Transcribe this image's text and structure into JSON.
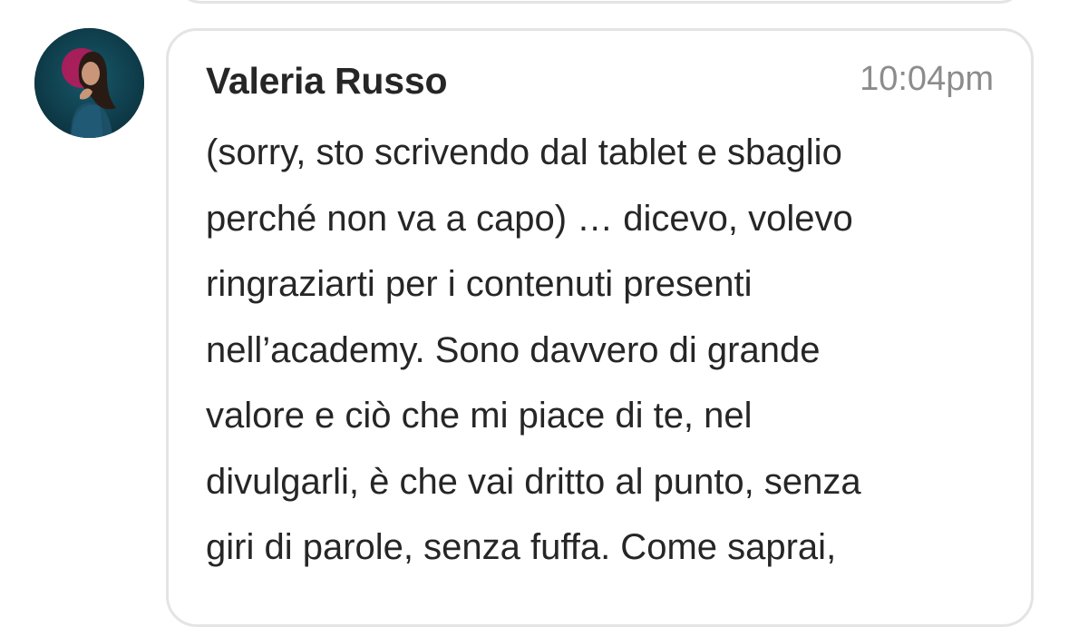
{
  "previous_message": {},
  "message": {
    "avatar_icon": "user-avatar-photo",
    "author": "Valeria Russo",
    "time": "10:04pm",
    "lines": [
      "(sorry, sto scrivendo dal tablet e sbaglio",
      "perché non va a capo) … dicevo, volevo",
      "ringraziarti per i contenuti presenti",
      "nell’academy. Sono davvero di grande",
      "valore e ciò che mi piace di te, nel",
      "divulgarli, è che vai dritto al punto, senza",
      "giri di parole, senza fuffa. Come saprai,"
    ]
  },
  "colors": {
    "bubble_border": "#e4e4e4",
    "text": "#262626",
    "timestamp": "#8c8c8c",
    "avatar_bg": "#0f3a48",
    "avatar_accent": "#c2185b"
  }
}
